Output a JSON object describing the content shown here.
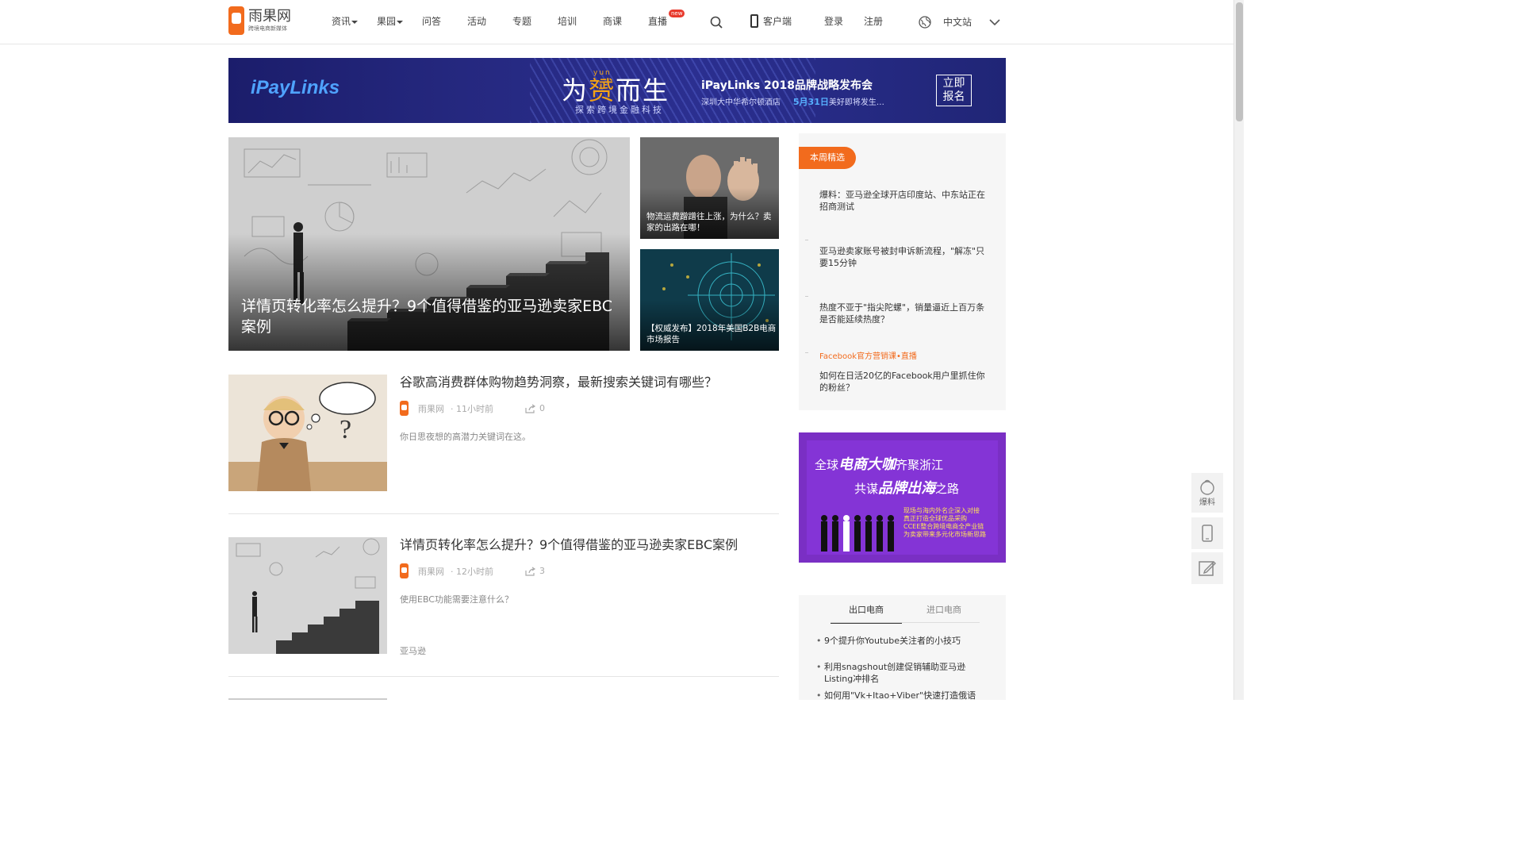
{
  "header": {
    "logo_name": "雨果网",
    "logo_slogan": "跨境电商新媒体",
    "nav": [
      {
        "label": "资讯",
        "has_dropdown": true
      },
      {
        "label": "果园",
        "has_dropdown": true
      },
      {
        "label": "问答",
        "has_dropdown": false
      },
      {
        "label": "活动",
        "has_dropdown": false
      },
      {
        "label": "专题",
        "has_dropdown": false
      },
      {
        "label": "培训",
        "has_dropdown": false
      },
      {
        "label": "商课",
        "has_dropdown": false
      },
      {
        "label": "直播",
        "has_dropdown": false,
        "badge": "new"
      }
    ],
    "client_label": "客户端",
    "login_label": "登录",
    "register_label": "注册",
    "lang_label": "中文站"
  },
  "banner": {
    "brand": "iPayLinks",
    "slogan_part1": "为",
    "slogan_highlight": "赟",
    "slogan_pinyin": "yun",
    "slogan_part2": "而生",
    "slogan_sub": "探索跨境金融科技",
    "title": "iPayLinks  2018品牌战略发布会",
    "venue": "深圳大中华希尔顿酒店",
    "date": "5月31日",
    "date_suffix": "美好即将发生…",
    "button_line1": "立即",
    "button_line2": "报名"
  },
  "hero": {
    "main_title": "详情页转化率怎么提升？9个值得借鉴的亚马逊卖家EBC案例",
    "side1_caption": "物流运费蹭蹭往上涨，为什么？卖家的出路在哪！",
    "side2_caption": "【权威发布】2018年美国B2B电商市场报告"
  },
  "articles": [
    {
      "title": "谷歌高消费群体购物趋势洞察，最新搜索关键词有哪些？",
      "source": "雨果网",
      "time": "· 11小时前",
      "shares": "0",
      "summary": "你日思夜想的高潜力关键词在这。",
      "tag": ""
    },
    {
      "title": "详情页转化率怎么提升？9个值得借鉴的亚马逊卖家EBC案例",
      "source": "雨果网",
      "time": "· 12小时前",
      "shares": "3",
      "summary": "使用EBC功能需要注意什么？",
      "tag": "亚马逊"
    }
  ],
  "weekly": {
    "badge": "本周精选",
    "items": [
      "爆料：亚马逊全球开店印度站、中东站正在招商测试",
      "亚马逊卖家账号被封申诉新流程，\"解冻\"只要15分钟",
      "热度不亚于\"指尖陀螺\"，销量逼近上百万条是否能延续热度？"
    ],
    "live_label": "Facebook官方营销课•直播",
    "live_item": "如何在日活20亿的Facebook用户里抓住你的粉丝？"
  },
  "ad2": {
    "line1_a": "全球",
    "line1_b": "电商大咖",
    "line1_c": "齐聚浙江",
    "line2_a": "共谋",
    "line2_b": "品牌出海",
    "line2_c": "之路",
    "bullets": [
      "现场与海内外名企深入对接",
      "真正打造全球优品采购",
      "CCEE整合跨境电商全产业链",
      "为卖家带来多元化市场新思路"
    ]
  },
  "tabs": {
    "items": [
      "出口电商",
      "进口电商"
    ],
    "active": "出口电商",
    "list": [
      "9个提升你Youtube关注者的小技巧",
      "利用snagshout创建促销辅助亚马逊Listing冲排名",
      "如何用\"Vk+Itao+Viber\"快速打造俄语市场"
    ]
  },
  "float_toolbar": {
    "report_label": "爆料"
  },
  "colors": {
    "accent": "#f26b1d",
    "banner_bg": "#25287f",
    "ad_purple": "#8434d6"
  }
}
